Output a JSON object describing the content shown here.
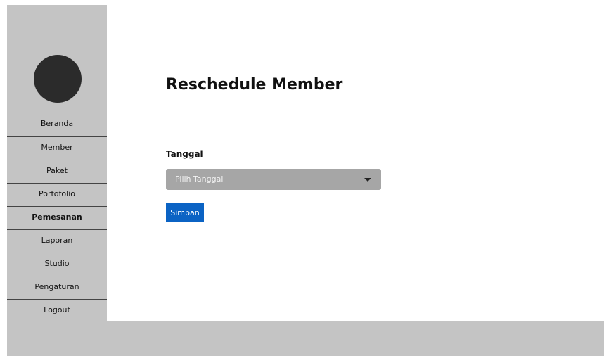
{
  "sidebar": {
    "items": [
      {
        "label": "Beranda"
      },
      {
        "label": "Member"
      },
      {
        "label": "Paket"
      },
      {
        "label": "Portofolio"
      },
      {
        "label": "Pemesanan",
        "active": true
      },
      {
        "label": "Laporan"
      },
      {
        "label": "Studio"
      },
      {
        "label": "Pengaturan"
      },
      {
        "label": "Logout"
      }
    ]
  },
  "main": {
    "title": "Reschedule Member",
    "date_field": {
      "label": "Tanggal",
      "placeholder": "Pilih Tanggal",
      "icon": "caret-down-icon"
    },
    "save_label": "Simpan"
  },
  "colors": {
    "sidebar_bg": "#c4c4c4",
    "avatar": "#2b2b2b",
    "select_bg": "#a6a6a6",
    "primary_button": "#0b63c4"
  }
}
